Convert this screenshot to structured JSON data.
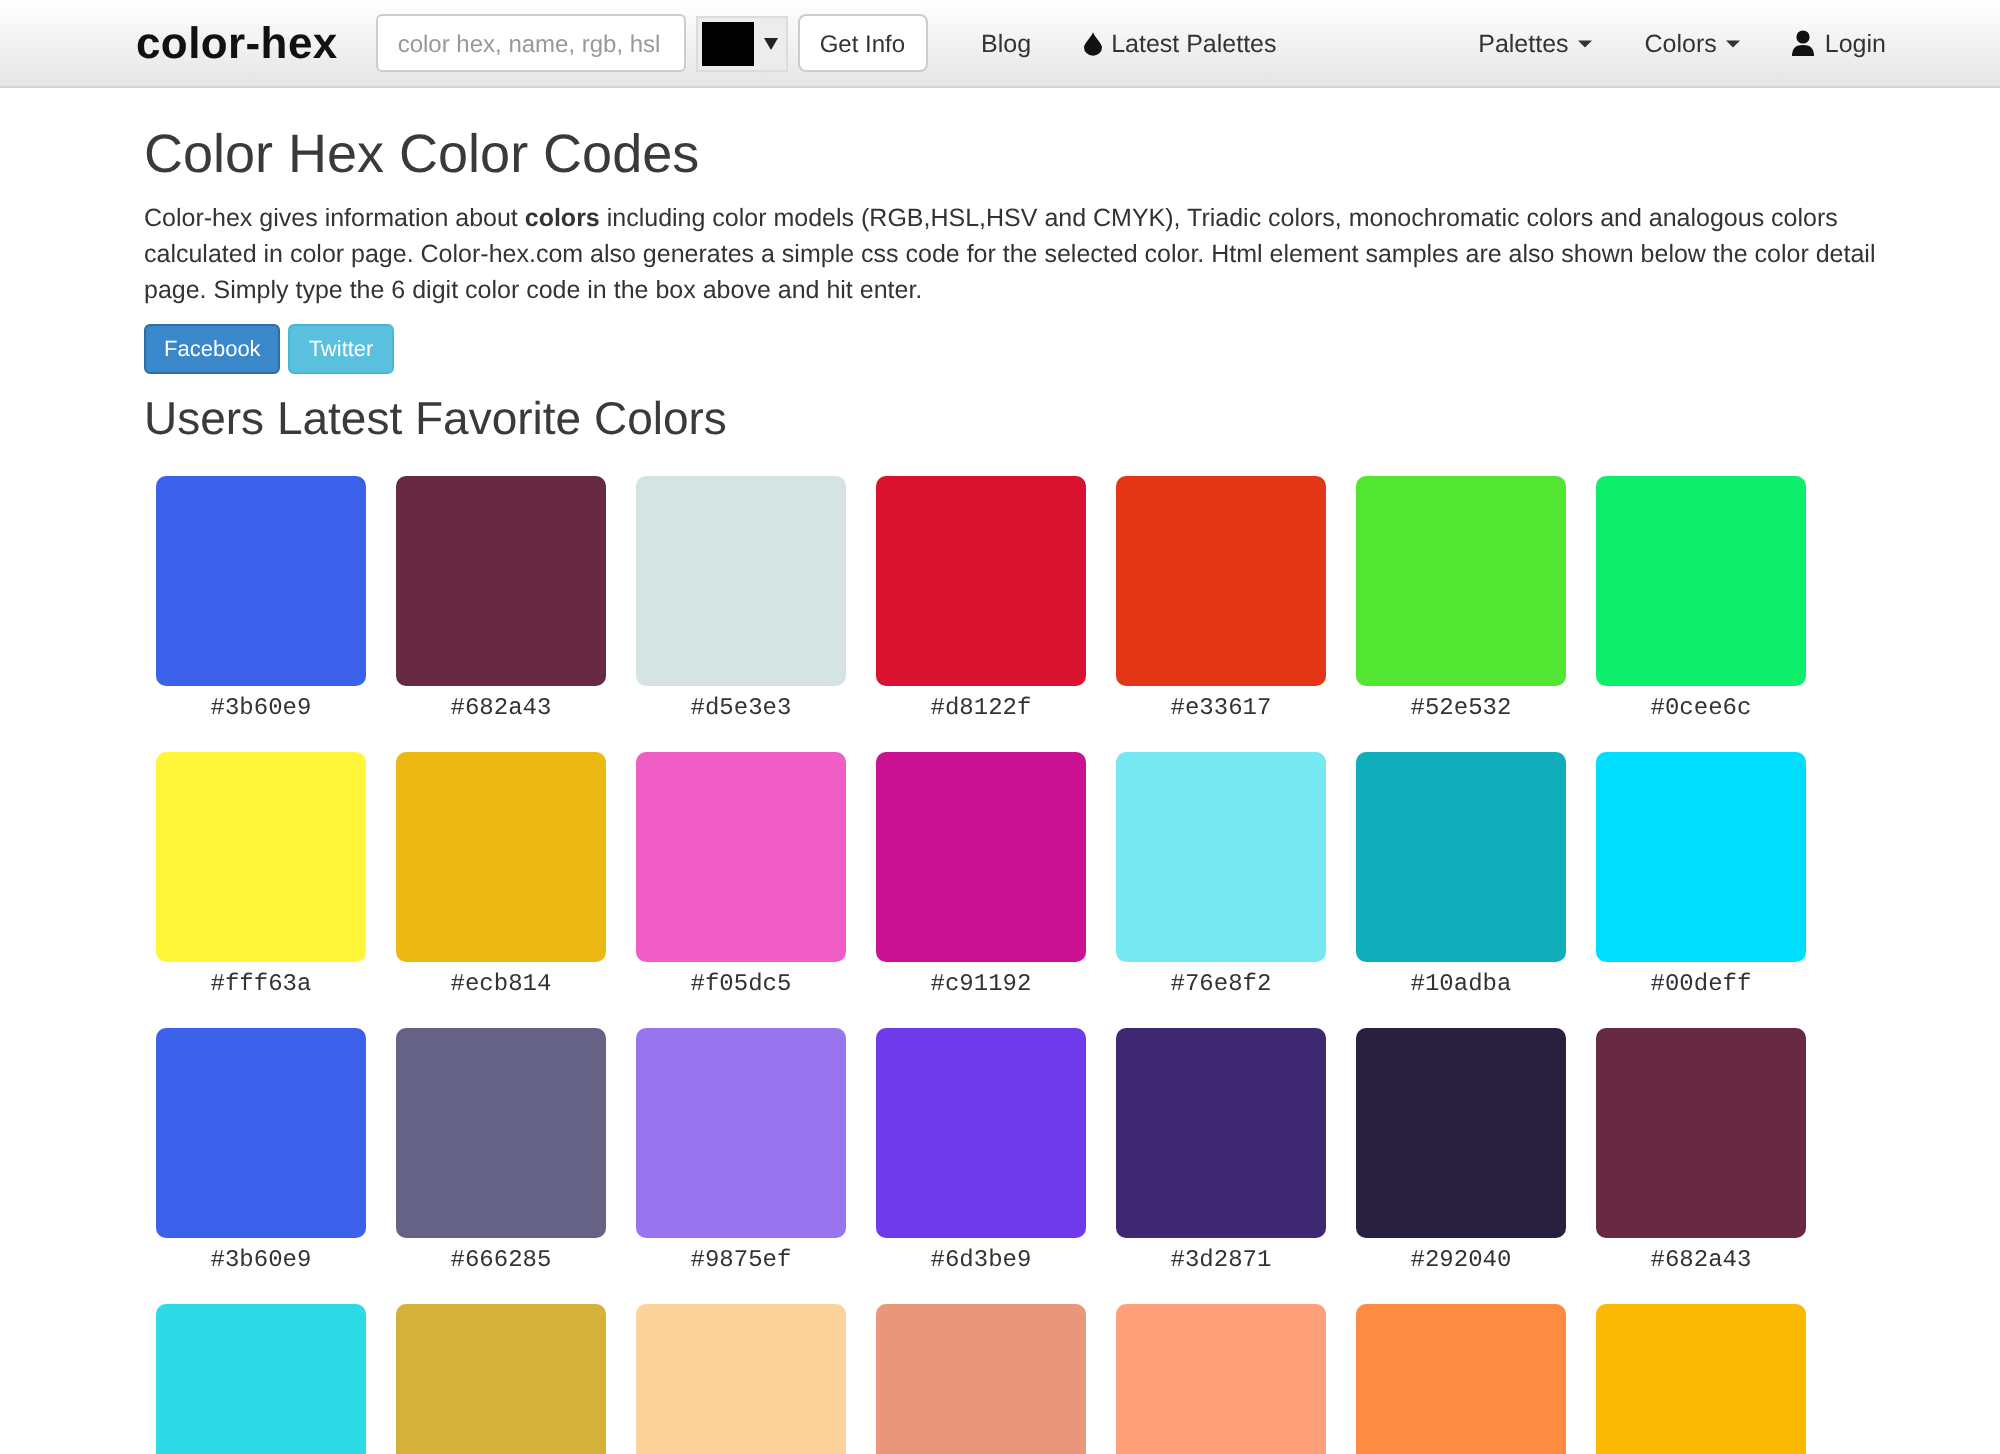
{
  "navbar": {
    "logo": "color-hex",
    "search": {
      "placeholder": "color hex, name, rgb, hsl"
    },
    "color_picker": {
      "color": "#000000"
    },
    "button": "Get Info",
    "left_links": [
      {
        "label": "Blog",
        "kind": "link"
      },
      {
        "label": "Latest Palettes",
        "kind": "palettes"
      }
    ],
    "right_links": [
      {
        "label": "Palettes",
        "kind": "menu"
      },
      {
        "label": "Colors",
        "kind": "menu"
      },
      {
        "label": "Login",
        "kind": "account"
      }
    ]
  },
  "intro": {
    "title": "Color Hex Color Codes",
    "text": "Color-hex gives information about **colors** including color models (RGB,HSL,HSV and CMYK), Triadic colors, monochromatic colors and analogous colors calculated in color page. Color-hex.com also generates a simple css code for the selected color. Html element samples are also shown below the color detail page. Simply type the 6 digit color code in the box above and hit enter.",
    "share_buttons": [
      {
        "label": "Facebook",
        "kind": "facebook"
      },
      {
        "label": "Twitter",
        "kind": "twitter"
      }
    ]
  },
  "favorites": {
    "title": "Users Latest Favorite Colors",
    "swatches": [
      {
        "color": "#3b60e9",
        "label": "#3b60e9"
      },
      {
        "color": "#682a43",
        "label": "#682a43"
      },
      {
        "color": "#d5e3e3",
        "label": "#d5e3e3"
      },
      {
        "color": "#d8122f",
        "label": "#d8122f"
      },
      {
        "color": "#e33617",
        "label": "#e33617"
      },
      {
        "color": "#52e532",
        "label": "#52e532"
      },
      {
        "color": "#0cee6c",
        "label": "#0cee6c"
      },
      {
        "color": "#fff63a",
        "label": "#fff63a"
      },
      {
        "color": "#ecb814",
        "label": "#ecb814"
      },
      {
        "color": "#f05dc5",
        "label": "#f05dc5"
      },
      {
        "color": "#c91192",
        "label": "#c91192"
      },
      {
        "color": "#76e8f2",
        "label": "#76e8f2"
      },
      {
        "color": "#10adba",
        "label": "#10adba"
      },
      {
        "color": "#00deff",
        "label": "#00deff"
      },
      {
        "color": "#3b60e9",
        "label": "#3b60e9"
      },
      {
        "color": "#666285",
        "label": "#666285"
      },
      {
        "color": "#9875ef",
        "label": "#9875ef"
      },
      {
        "color": "#6d3be9",
        "label": "#6d3be9"
      },
      {
        "color": "#3d2871",
        "label": "#3d2871"
      },
      {
        "color": "#292040",
        "label": "#292040"
      },
      {
        "color": "#682a43",
        "label": "#682a43"
      },
      {
        "color": "#2ddbe6"
      },
      {
        "color": "#d4b138"
      },
      {
        "color": "#fdd39c"
      },
      {
        "color": "#ea967a"
      },
      {
        "color": "#ffa07a"
      },
      {
        "color": "#ff8b43"
      },
      {
        "color": "#fbb904"
      }
    ]
  }
}
